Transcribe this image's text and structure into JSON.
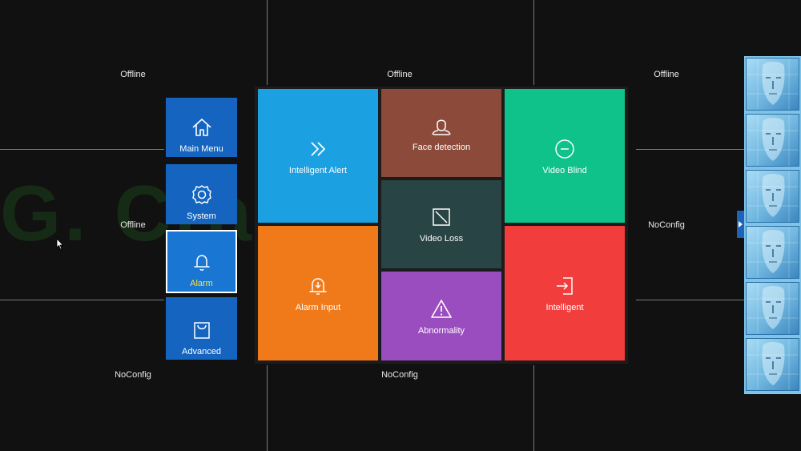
{
  "watermark": "G. Craftsman",
  "camera_grid": {
    "cells": [
      {
        "status": "Offline"
      },
      {
        "status": "Offline"
      },
      {
        "status": "Offline"
      },
      {
        "status": "Offline"
      },
      {
        "status": "NoConfig"
      },
      {
        "status": "NoConfig"
      },
      {
        "status": "NoConfig"
      }
    ]
  },
  "side_menu": {
    "items": [
      {
        "label": "Main Menu",
        "icon": "home-icon"
      },
      {
        "label": "System",
        "icon": "gear-icon"
      },
      {
        "label": "Alarm",
        "icon": "bell-icon",
        "active": true
      },
      {
        "label": "Advanced",
        "icon": "bag-icon"
      }
    ]
  },
  "alarm_panel": {
    "tiles": [
      {
        "label": "Intelligent Alert",
        "icon": "double-chevron-right-icon",
        "color": "#1ba1e2"
      },
      {
        "label": "Face detection",
        "icon": "face-detection-icon",
        "color": "#8b4a3a"
      },
      {
        "label": "Video Blind",
        "icon": "circle-minus-icon",
        "color": "#0fc28a"
      },
      {
        "label": "Video Loss",
        "icon": "video-loss-icon",
        "color": "#284444"
      },
      {
        "label": "Alarm Input",
        "icon": "alarm-bell-icon",
        "color": "#f07a1a"
      },
      {
        "label": "Abnormality",
        "icon": "warning-triangle-icon",
        "color": "#9a4dbf"
      },
      {
        "label": "Intelligent",
        "icon": "enter-arrow-icon",
        "color": "#f23d3d"
      }
    ]
  },
  "colors": {
    "background": "#111111",
    "side_tile": "#1565c0",
    "active_label": "#ffe135",
    "face_strip": "#7fc4e8"
  }
}
